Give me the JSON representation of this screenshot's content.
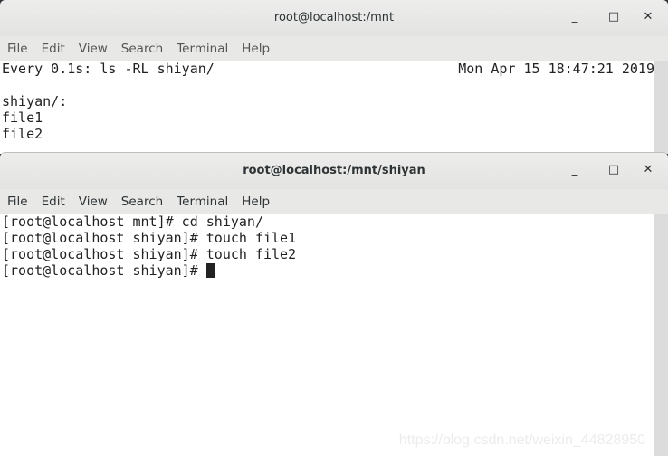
{
  "menu": [
    "File",
    "Edit",
    "View",
    "Search",
    "Terminal",
    "Help"
  ],
  "window_top": {
    "title": "root@localhost:/mnt",
    "watch_header": "Every 0.1s: ls -RL shiyan/",
    "timestamp": "Mon Apr 15 18:47:21 2019",
    "lines": [
      "",
      "shiyan/:",
      "file1",
      "file2"
    ]
  },
  "window_bottom": {
    "title": "root@localhost:/mnt/shiyan",
    "lines": [
      "[root@localhost mnt]# cd shiyan/",
      "[root@localhost shiyan]# touch file1",
      "[root@localhost shiyan]# touch file2"
    ],
    "prompt": "[root@localhost shiyan]# "
  },
  "controls": {
    "minimize": "_",
    "maximize": "□",
    "close": "✕"
  },
  "watermark": "https://blog.csdn.net/weixin_44828950"
}
